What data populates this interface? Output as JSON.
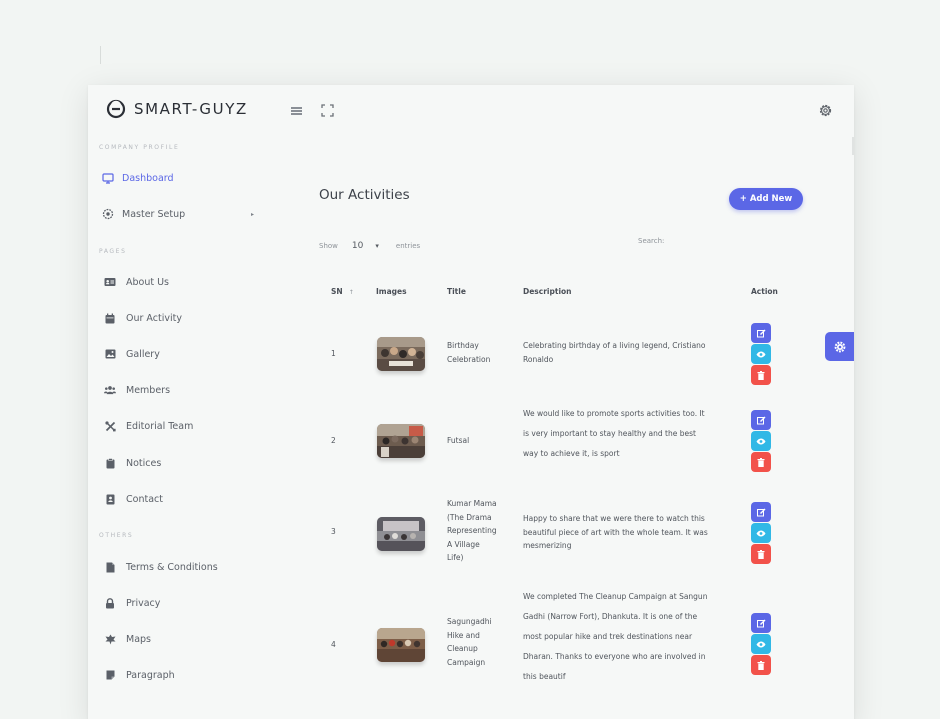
{
  "brand": {
    "name": "SMART-GUYZ"
  },
  "colors": {
    "accent": "#5b67e6",
    "info": "#31b8e6",
    "danger": "#f2524a"
  },
  "sidebar": {
    "sections": [
      {
        "title": "COMPANY PROFILE"
      },
      {
        "title": "PAGES"
      },
      {
        "title": "OTHERS"
      }
    ],
    "items": [
      {
        "label": "Dashboard",
        "icon": "monitor-icon"
      },
      {
        "label": "Master Setup",
        "icon": "gear-icon"
      },
      {
        "label": "About Us",
        "icon": "id-card-icon"
      },
      {
        "label": "Our Activity",
        "icon": "calendar-icon"
      },
      {
        "label": "Gallery",
        "icon": "image-icon"
      },
      {
        "label": "Members",
        "icon": "users-icon"
      },
      {
        "label": "Editorial Team",
        "icon": "tools-icon"
      },
      {
        "label": "Notices",
        "icon": "clipboard-icon"
      },
      {
        "label": "Contact",
        "icon": "contact-book-icon"
      },
      {
        "label": "Terms & Conditions",
        "icon": "file-icon"
      },
      {
        "label": "Privacy",
        "icon": "lock-icon"
      },
      {
        "label": "Maps",
        "icon": "map-leaf-icon"
      },
      {
        "label": "Paragraph",
        "icon": "note-icon"
      }
    ]
  },
  "main": {
    "title": "Our Activities",
    "add_button": "+ Add New",
    "show_label": "Show",
    "show_value": "10",
    "entries_label": "entries",
    "search_label": "Search:",
    "columns": [
      "SN",
      "Images",
      "Title",
      "Description",
      "Action"
    ],
    "rows": [
      {
        "sn": "1",
        "title_lines": [
          "Birthday",
          "Celebration"
        ],
        "desc_lines": [
          "Celebrating birthday of a living legend, Cristiano",
          "Ronaldo"
        ]
      },
      {
        "sn": "2",
        "title_lines": [
          "Futsal"
        ],
        "desc_lines": [
          "We would like to promote sports activities too. It",
          "is very important to stay healthy and the best",
          "way to achieve it, is sport"
        ]
      },
      {
        "sn": "3",
        "title_lines": [
          "Kumar Mama",
          "(The Drama",
          "Representing",
          "A Village",
          "Life)"
        ],
        "desc_lines": [
          "Happy to share that we were there to watch this",
          "beautiful piece of art with the whole team. It was",
          "mesmerizing"
        ]
      },
      {
        "sn": "4",
        "title_lines": [
          "Sagungadhi",
          "Hike and",
          "Cleanup",
          "Campaign"
        ],
        "desc_lines": [
          "We completed The Cleanup Campaign at Sangun",
          "Gadhi (Narrow Fort), Dhankuta. It is one of the",
          "most popular hike and trek destinations near",
          "Dharan. Thanks to everyone who are involved in",
          "this beautif"
        ]
      }
    ]
  }
}
